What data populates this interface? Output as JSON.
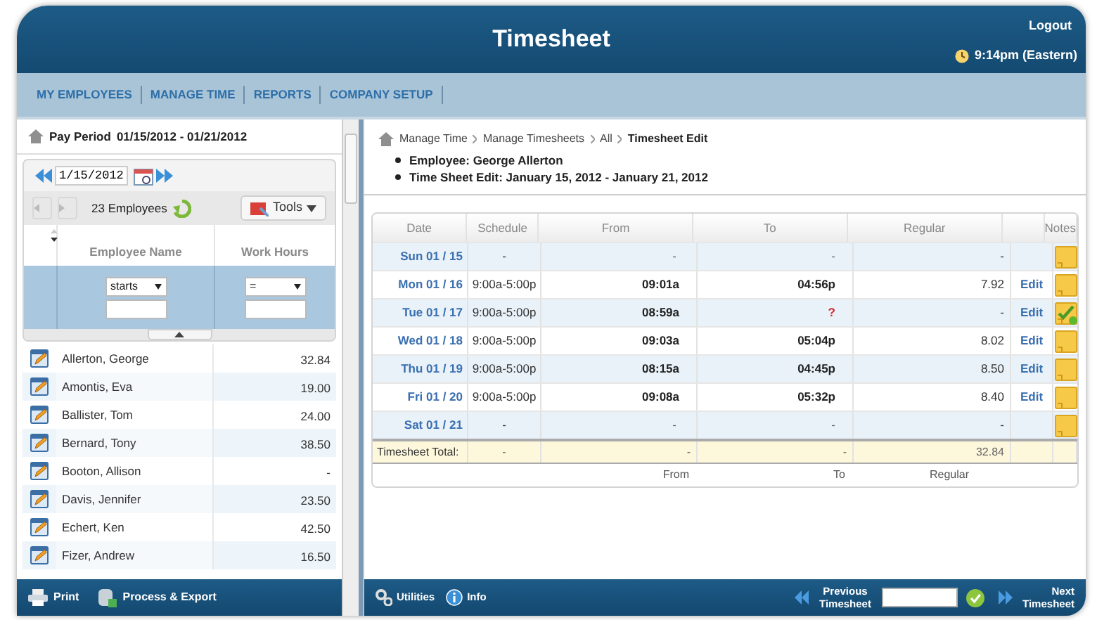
{
  "header": {
    "title": "Timesheet",
    "logout": "Logout",
    "time": "9:14pm (Eastern)"
  },
  "nav": [
    {
      "label": "MY EMPLOYEES"
    },
    {
      "label": "MANAGE TIME"
    },
    {
      "label": "REPORTS"
    },
    {
      "label": "COMPANY SETUP"
    }
  ],
  "left_panel": {
    "pay_period_label": "Pay Period",
    "pay_period": "01/15/2012 - 01/21/2012",
    "date": "1/15/2012",
    "employee_count": "23 Employees",
    "tools": "Tools",
    "columns": [
      "Employee Name",
      "Work Hours"
    ],
    "filters": [
      {
        "operator": "starts"
      },
      {
        "operator": "="
      }
    ],
    "employees": [
      {
        "name": "Allerton, George",
        "hours": "32.84"
      },
      {
        "name": "Amontis, Eva",
        "hours": "19.00"
      },
      {
        "name": "Ballister, Tom",
        "hours": "24.00"
      },
      {
        "name": "Bernard, Tony",
        "hours": "38.50"
      },
      {
        "name": "Booton, Allison",
        "hours": "-"
      },
      {
        "name": "Davis, Jennifer",
        "hours": "23.50"
      },
      {
        "name": "Echert, Ken",
        "hours": "42.50"
      },
      {
        "name": "Fizer, Andrew",
        "hours": "16.50"
      }
    ],
    "footer": [
      {
        "kind": "print",
        "label": "Print"
      },
      {
        "kind": "export",
        "label": "Process & Export"
      }
    ]
  },
  "main": {
    "breadcrumb": [
      "Manage Time",
      "Manage Timesheets",
      "All",
      "Timesheet Edit"
    ],
    "details": [
      "Employee: George Allerton",
      "Time Sheet Edit: January 15, 2012 - January 21, 2012"
    ],
    "table": {
      "columns": [
        "Date",
        "Schedule",
        "From",
        "To",
        "Regular",
        "Notes"
      ],
      "rows": [
        {
          "date": "Sun 01 / 15",
          "schedule": "-",
          "from": "-",
          "to": "-",
          "to_missing": false,
          "regular": "-",
          "note_approved": false
        },
        {
          "date": "Mon 01 / 16",
          "schedule": "9:00a-5:00p",
          "from": "09:01a",
          "to": "04:56p",
          "to_missing": false,
          "regular": "7.92",
          "edit": "Edit",
          "note_approved": false
        },
        {
          "date": "Tue 01 / 17",
          "schedule": "9:00a-5:00p",
          "from": "08:59a",
          "to": "?",
          "to_missing": true,
          "regular": "-",
          "edit": "Edit",
          "note_approved": true
        },
        {
          "date": "Wed 01 / 18",
          "schedule": "9:00a-5:00p",
          "from": "09:03a",
          "to": "05:04p",
          "to_missing": false,
          "regular": "8.02",
          "edit": "Edit",
          "note_approved": false
        },
        {
          "date": "Thu 01 / 19",
          "schedule": "9:00a-5:00p",
          "from": "08:15a",
          "to": "04:45p",
          "to_missing": false,
          "regular": "8.50",
          "edit": "Edit",
          "note_approved": false
        },
        {
          "date": "Fri 01 / 20",
          "schedule": "9:00a-5:00p",
          "from": "09:08a",
          "to": "05:32p",
          "to_missing": false,
          "regular": "8.40",
          "edit": "Edit",
          "note_approved": false
        },
        {
          "date": "Sat 01 / 21",
          "schedule": "-",
          "from": "-",
          "to": "-",
          "to_missing": false,
          "regular": "-",
          "note_approved": false
        }
      ],
      "total": {
        "label": "Timesheet Total:",
        "schedule": "-",
        "from": "-",
        "to": "-",
        "regular": "32.84"
      },
      "footer_labels": [
        "From",
        "To",
        "Regular"
      ]
    }
  },
  "bottom_bar": {
    "utilities": "Utilities",
    "info": "Info",
    "previous": "Previous Timesheet",
    "next": "Next Timesheet"
  }
}
